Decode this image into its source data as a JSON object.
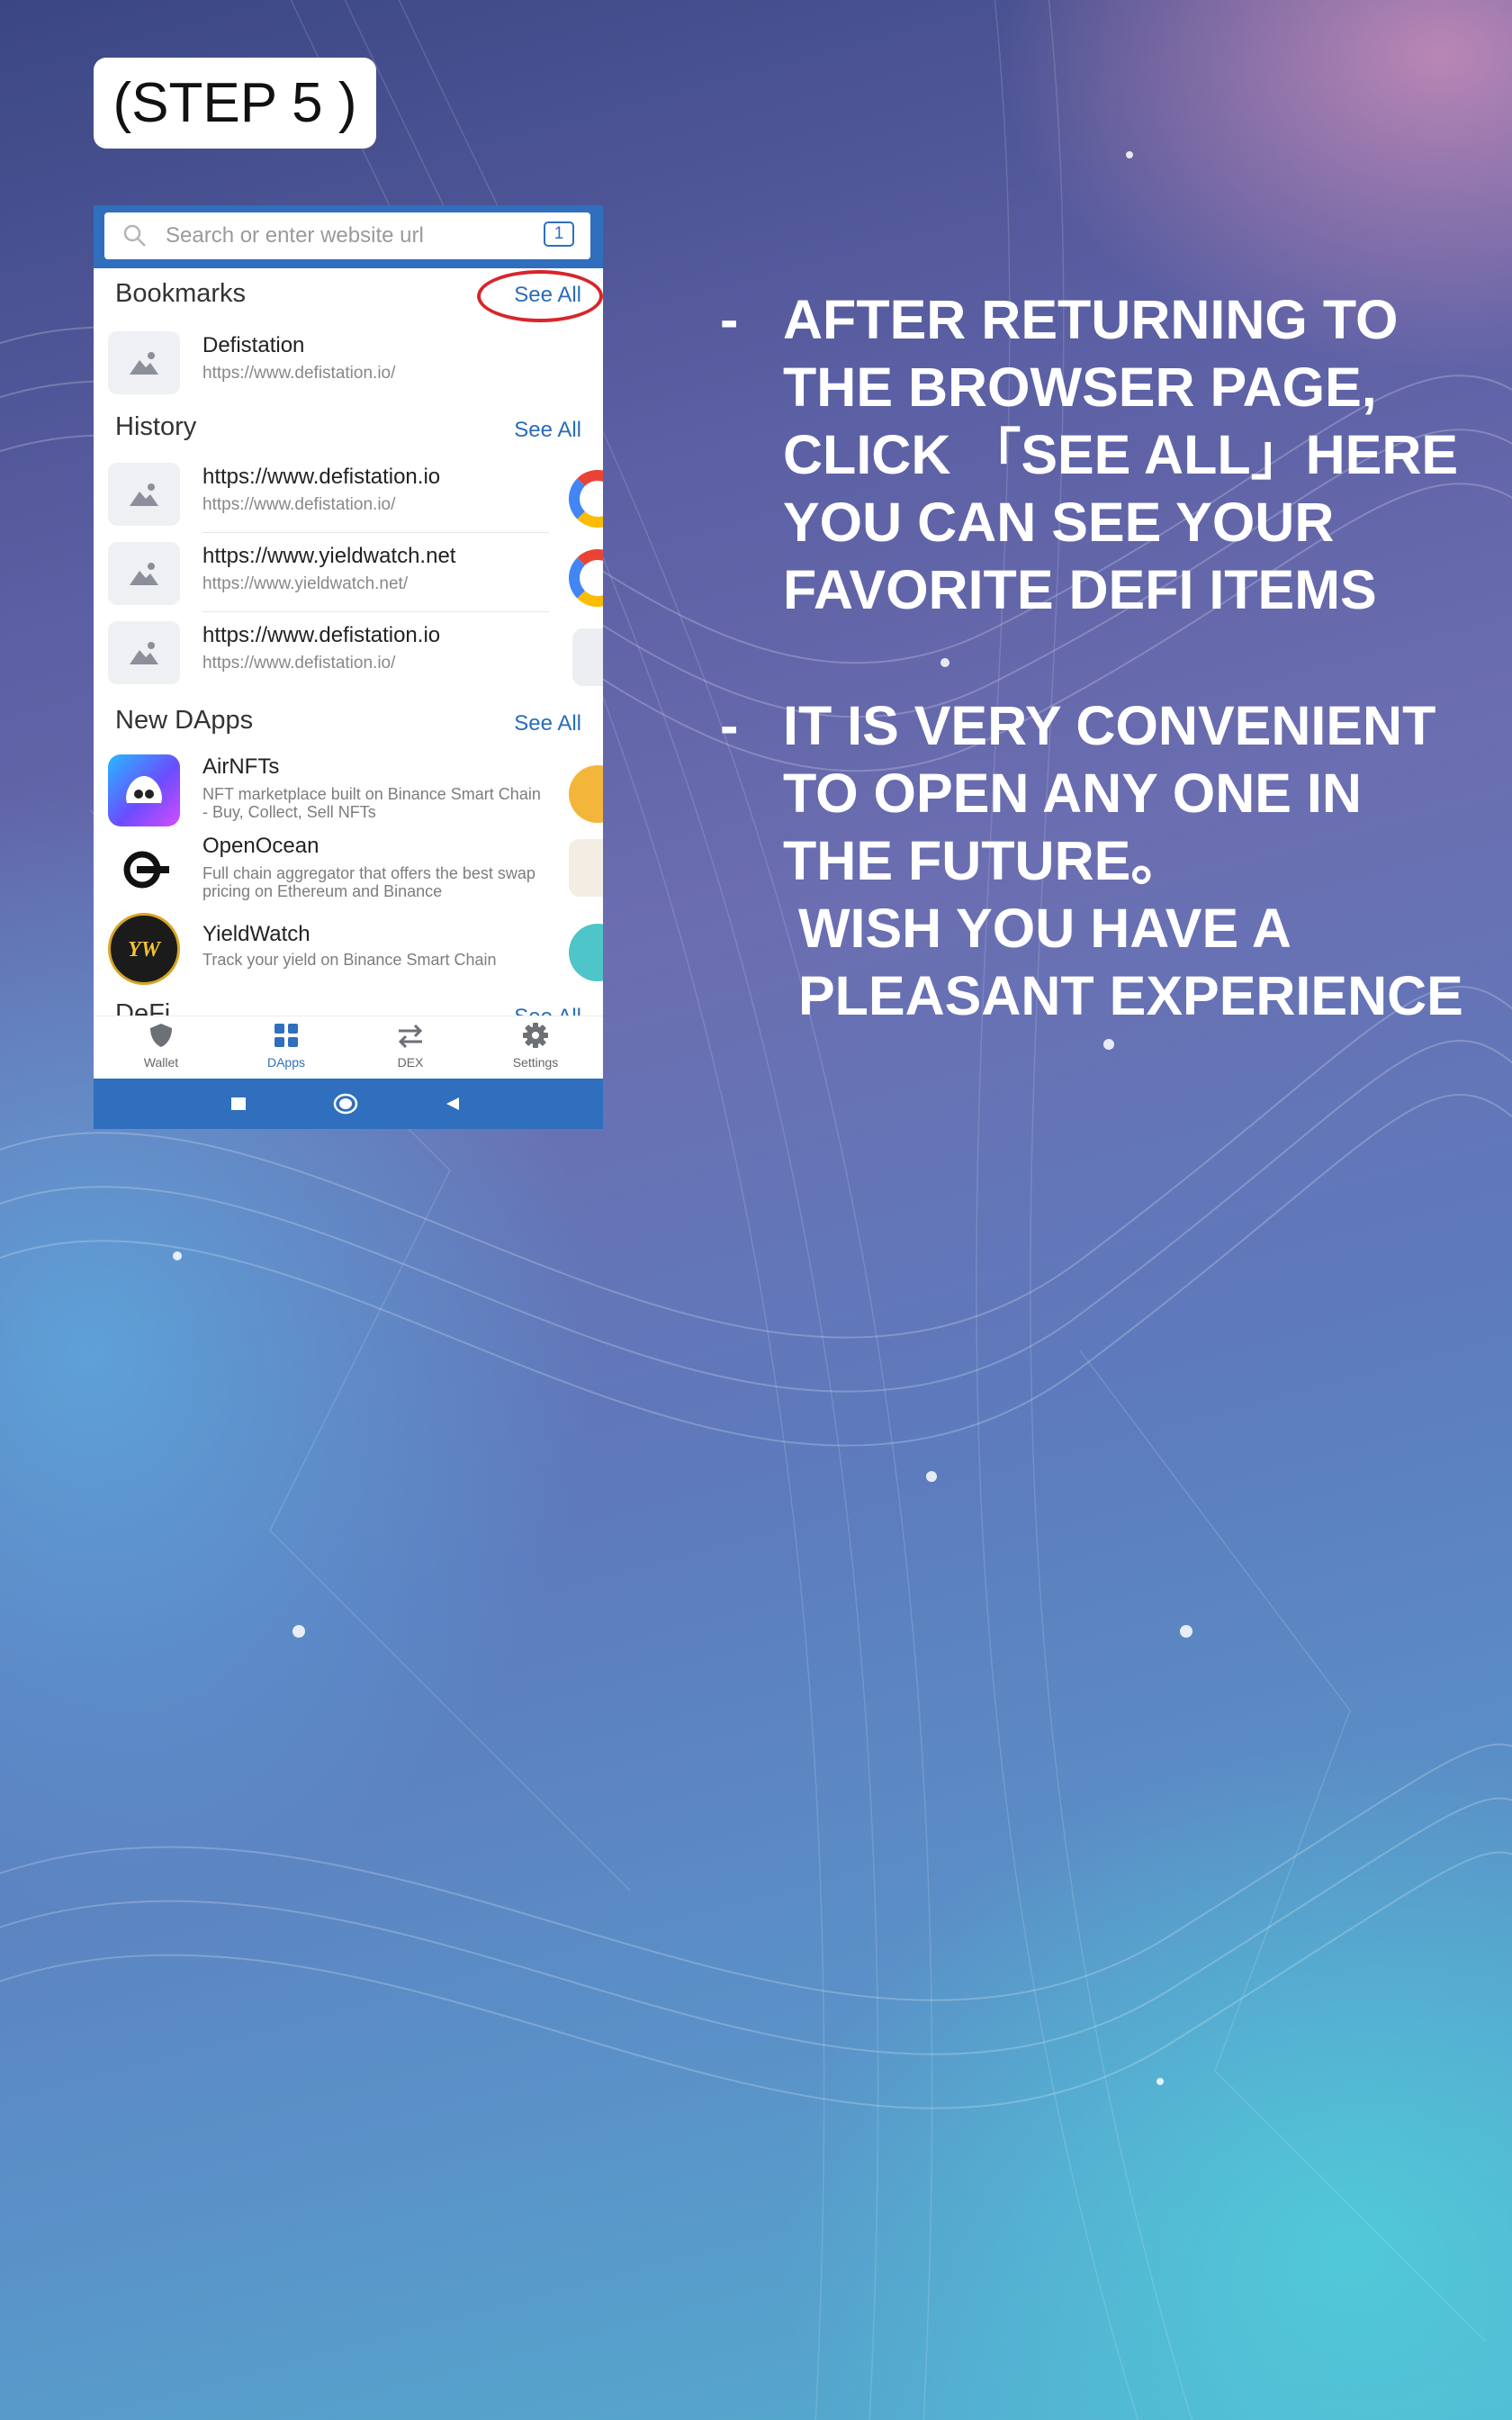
{
  "step_label": "(STEP 5 )",
  "browser": {
    "search_placeholder": "Search or enter website url",
    "tab_count": "1",
    "bookmarks": {
      "title": "Bookmarks",
      "see_all": "See All",
      "items": [
        {
          "title": "Defistation",
          "url": "https://www.defistation.io/"
        }
      ]
    },
    "history": {
      "title": "History",
      "see_all": "See All",
      "items": [
        {
          "title": "https://www.defistation.io",
          "url": "https://www.defistation.io/"
        },
        {
          "title": "https://www.yieldwatch.net",
          "url": "https://www.yieldwatch.net/"
        },
        {
          "title": "https://www.defistation.io",
          "url": "https://www.defistation.io/"
        }
      ]
    },
    "new_dapps": {
      "title": "New DApps",
      "see_all": "See All",
      "items": [
        {
          "name": "AirNFTs",
          "desc": "NFT marketplace built on Binance Smart Chain - Buy, Collect, Sell NFTs"
        },
        {
          "name": "OpenOcean",
          "desc": "Full chain aggregator that offers the best swap pricing on Ethereum and Binance"
        },
        {
          "name": "YieldWatch",
          "desc": "Track your yield on Binance Smart Chain"
        }
      ]
    },
    "defi": {
      "title": "DeFi",
      "see_all": "See All"
    },
    "bottom_nav": [
      {
        "label": "Wallet",
        "icon": "shield-icon"
      },
      {
        "label": "DApps",
        "icon": "grid-icon"
      },
      {
        "label": "DEX",
        "icon": "swap-arrows-icon"
      },
      {
        "label": "Settings",
        "icon": "gear-icon"
      }
    ],
    "colors": {
      "brand": "#2f6fbd",
      "highlight": "#d7262b"
    }
  },
  "instructions": [
    {
      "bullet": "-",
      "lines": [
        "AFTER RETURNING TO",
        "THE BROWSER PAGE,",
        "CLICK 「SEE ALL」HERE",
        "YOU CAN SEE YOUR",
        "FAVORITE DEFI ITEMS"
      ]
    },
    {
      "bullet": "-",
      "lines": [
        "IT IS VERY CONVENIENT",
        "TO OPEN ANY ONE IN",
        "THE FUTURE。",
        " WISH YOU HAVE A",
        " PLEASANT EXPERIENCE"
      ]
    }
  ]
}
